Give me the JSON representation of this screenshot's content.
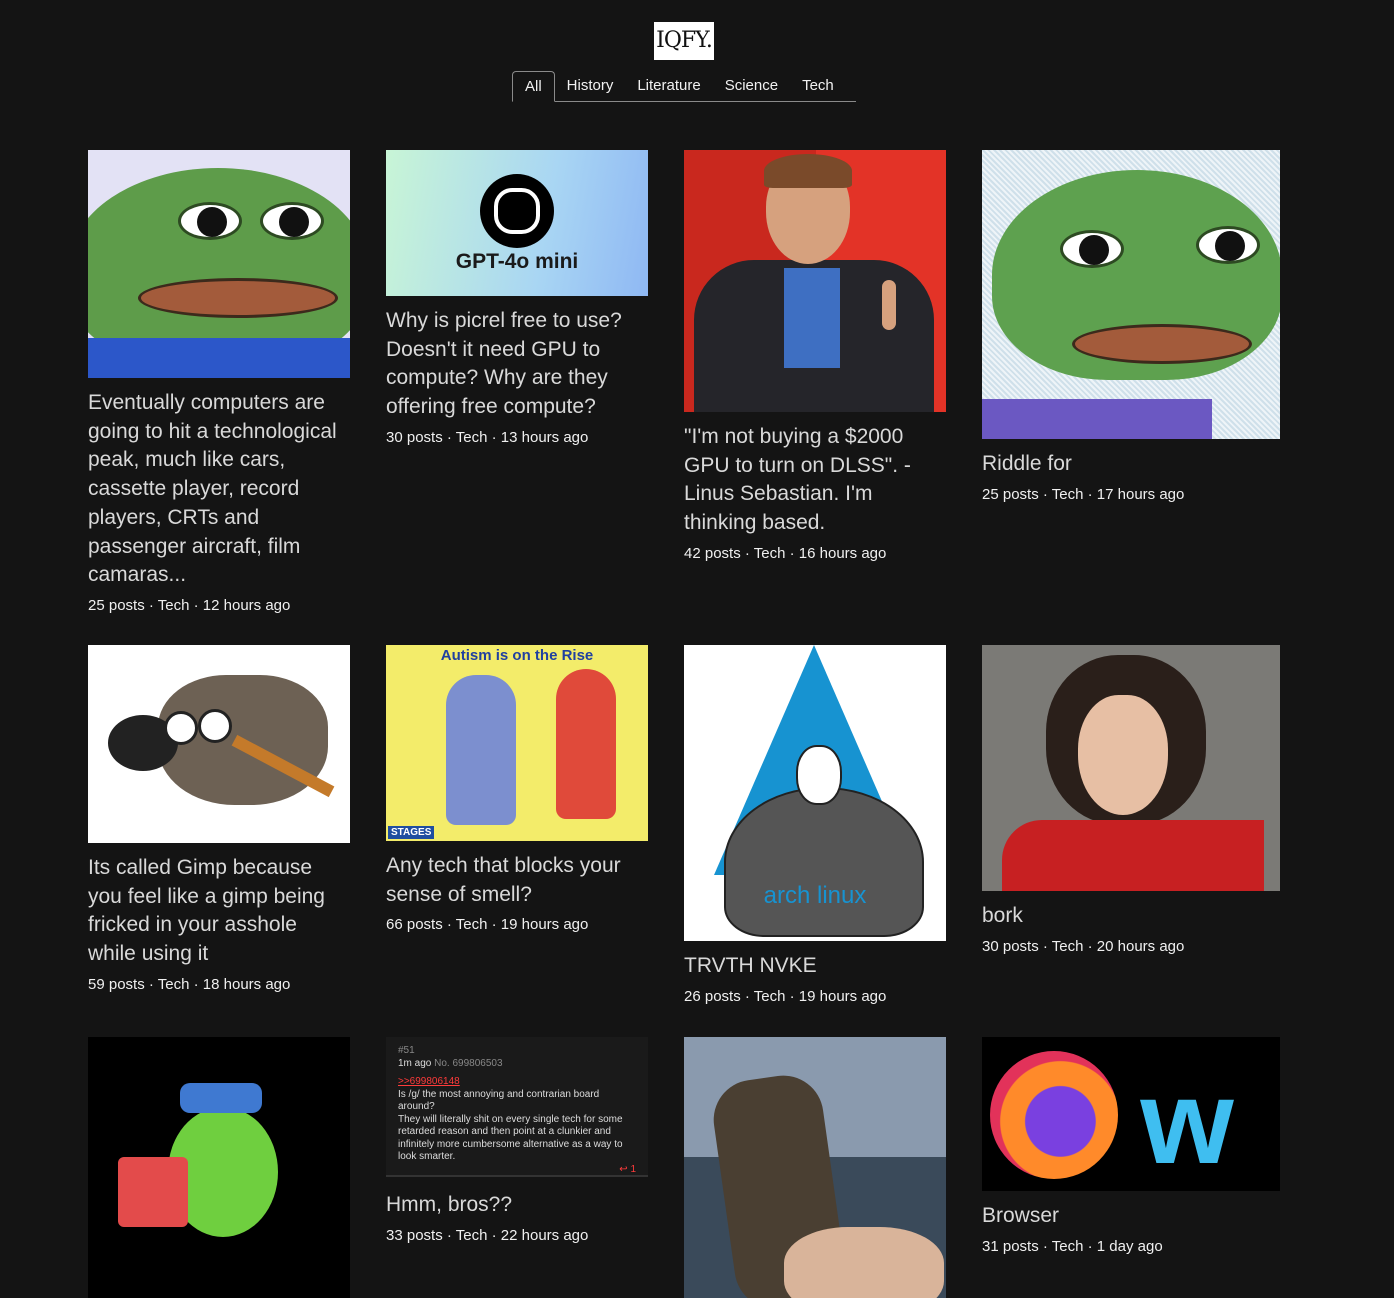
{
  "logo": "IQFY.",
  "tabs": [
    {
      "label": "All",
      "active": true
    },
    {
      "label": "History"
    },
    {
      "label": "Literature"
    },
    {
      "label": "Science"
    },
    {
      "label": "Tech"
    }
  ],
  "gpt_thumb_text": "GPT-4o mini",
  "autism_thumb": {
    "title": "Autism is on the Rise",
    "brand": "STAGES"
  },
  "arch_thumb_text": "arch linux",
  "chan_post": {
    "num": "#51",
    "time": "1m ago",
    "no": "No. 699806503",
    "reply": ">>699806148",
    "body": "Is /g/ the most annoying and contrarian board around?\nThey will literally shit on every single tech for some retarded reason and then point at a clunkier and infinitely more cumbersome alternative as a way to look smarter.",
    "count": "1"
  },
  "threads": [
    {
      "title": "Eventually computers are going to hit a technological peak, much like cars, cassette player, record players, CRTs and passenger aircraft, film camaras...",
      "meta": "25 posts · Tech · 12 hours ago"
    },
    {
      "title": "Why is picrel free to use? Doesn't it need GPU to compute? Why are they offering free compute?",
      "meta": "30 posts · Tech · 13 hours ago"
    },
    {
      "title": "\"I'm not buying a $2000 GPU to turn on DLSS\". - Linus Sebastian. I'm thinking based.",
      "meta": "42 posts · Tech · 16 hours ago"
    },
    {
      "title": "Riddle for",
      "meta": "25 posts · Tech · 17 hours ago"
    },
    {
      "title": "Its called Gimp because you feel like a gimp being fricked in your asshole while using it",
      "meta": "59 posts · Tech · 18 hours ago"
    },
    {
      "title": "Any tech that blocks your sense of smell?",
      "meta": "66 posts · Tech · 19 hours ago"
    },
    {
      "title": "TRVTH NVKE",
      "meta": "26 posts · Tech · 19 hours ago"
    },
    {
      "title": "bork",
      "meta": "30 posts · Tech · 20 hours ago"
    },
    {
      "title": "",
      "meta": ""
    },
    {
      "title": "Hmm, bros??",
      "meta": "33 posts · Tech · 22 hours ago"
    },
    {
      "title": "",
      "meta": ""
    },
    {
      "title": "Browser",
      "meta": "31 posts · Tech · 1 day ago"
    }
  ]
}
